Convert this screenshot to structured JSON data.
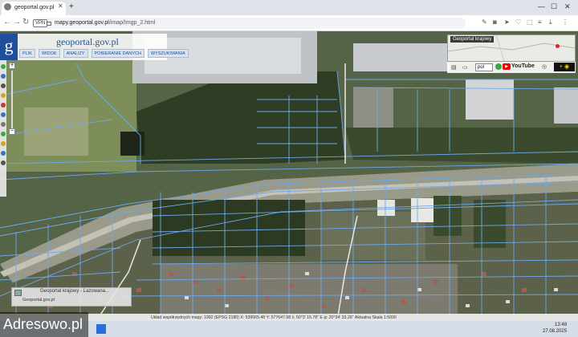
{
  "browser": {
    "tab_title": "geoportal.gov.pl",
    "new_tab": "+",
    "url_host": "mapy.geoportal.gov.pl",
    "url_path": "/imap/Imgp_2.html",
    "vpn": "VPN"
  },
  "geoportal": {
    "logo": "g",
    "title": "geoportal.gov.pl",
    "menu": [
      "PLIK",
      "WIDOK",
      "ANALIZY",
      "POBIERANIE DANYCH",
      "WYSZUKIWANIA"
    ]
  },
  "overview": {
    "title": "Geoportal krajowy",
    "layer_value": "pol",
    "youtube": "YouTube"
  },
  "legend": {
    "title": "Geoportal krajowy - Lazowana...",
    "subtitle": "Geoportal.gov.pl"
  },
  "status": {
    "text": "Układ współrzędnych mapy: 1992 (EPSG 2180)   X: 539565.48  Y: 577647.58   λ: 50°3' 15.78\" E  φ: 20°34' 33.26\"   Aktualna Skala 1:5000"
  },
  "watermark": "Adresowo.pl",
  "clock": {
    "time": "13:48",
    "date": "27.08.2025"
  },
  "colors": {
    "brand": "#1f4f9a",
    "parcel_lines": "#6fa8e8"
  }
}
